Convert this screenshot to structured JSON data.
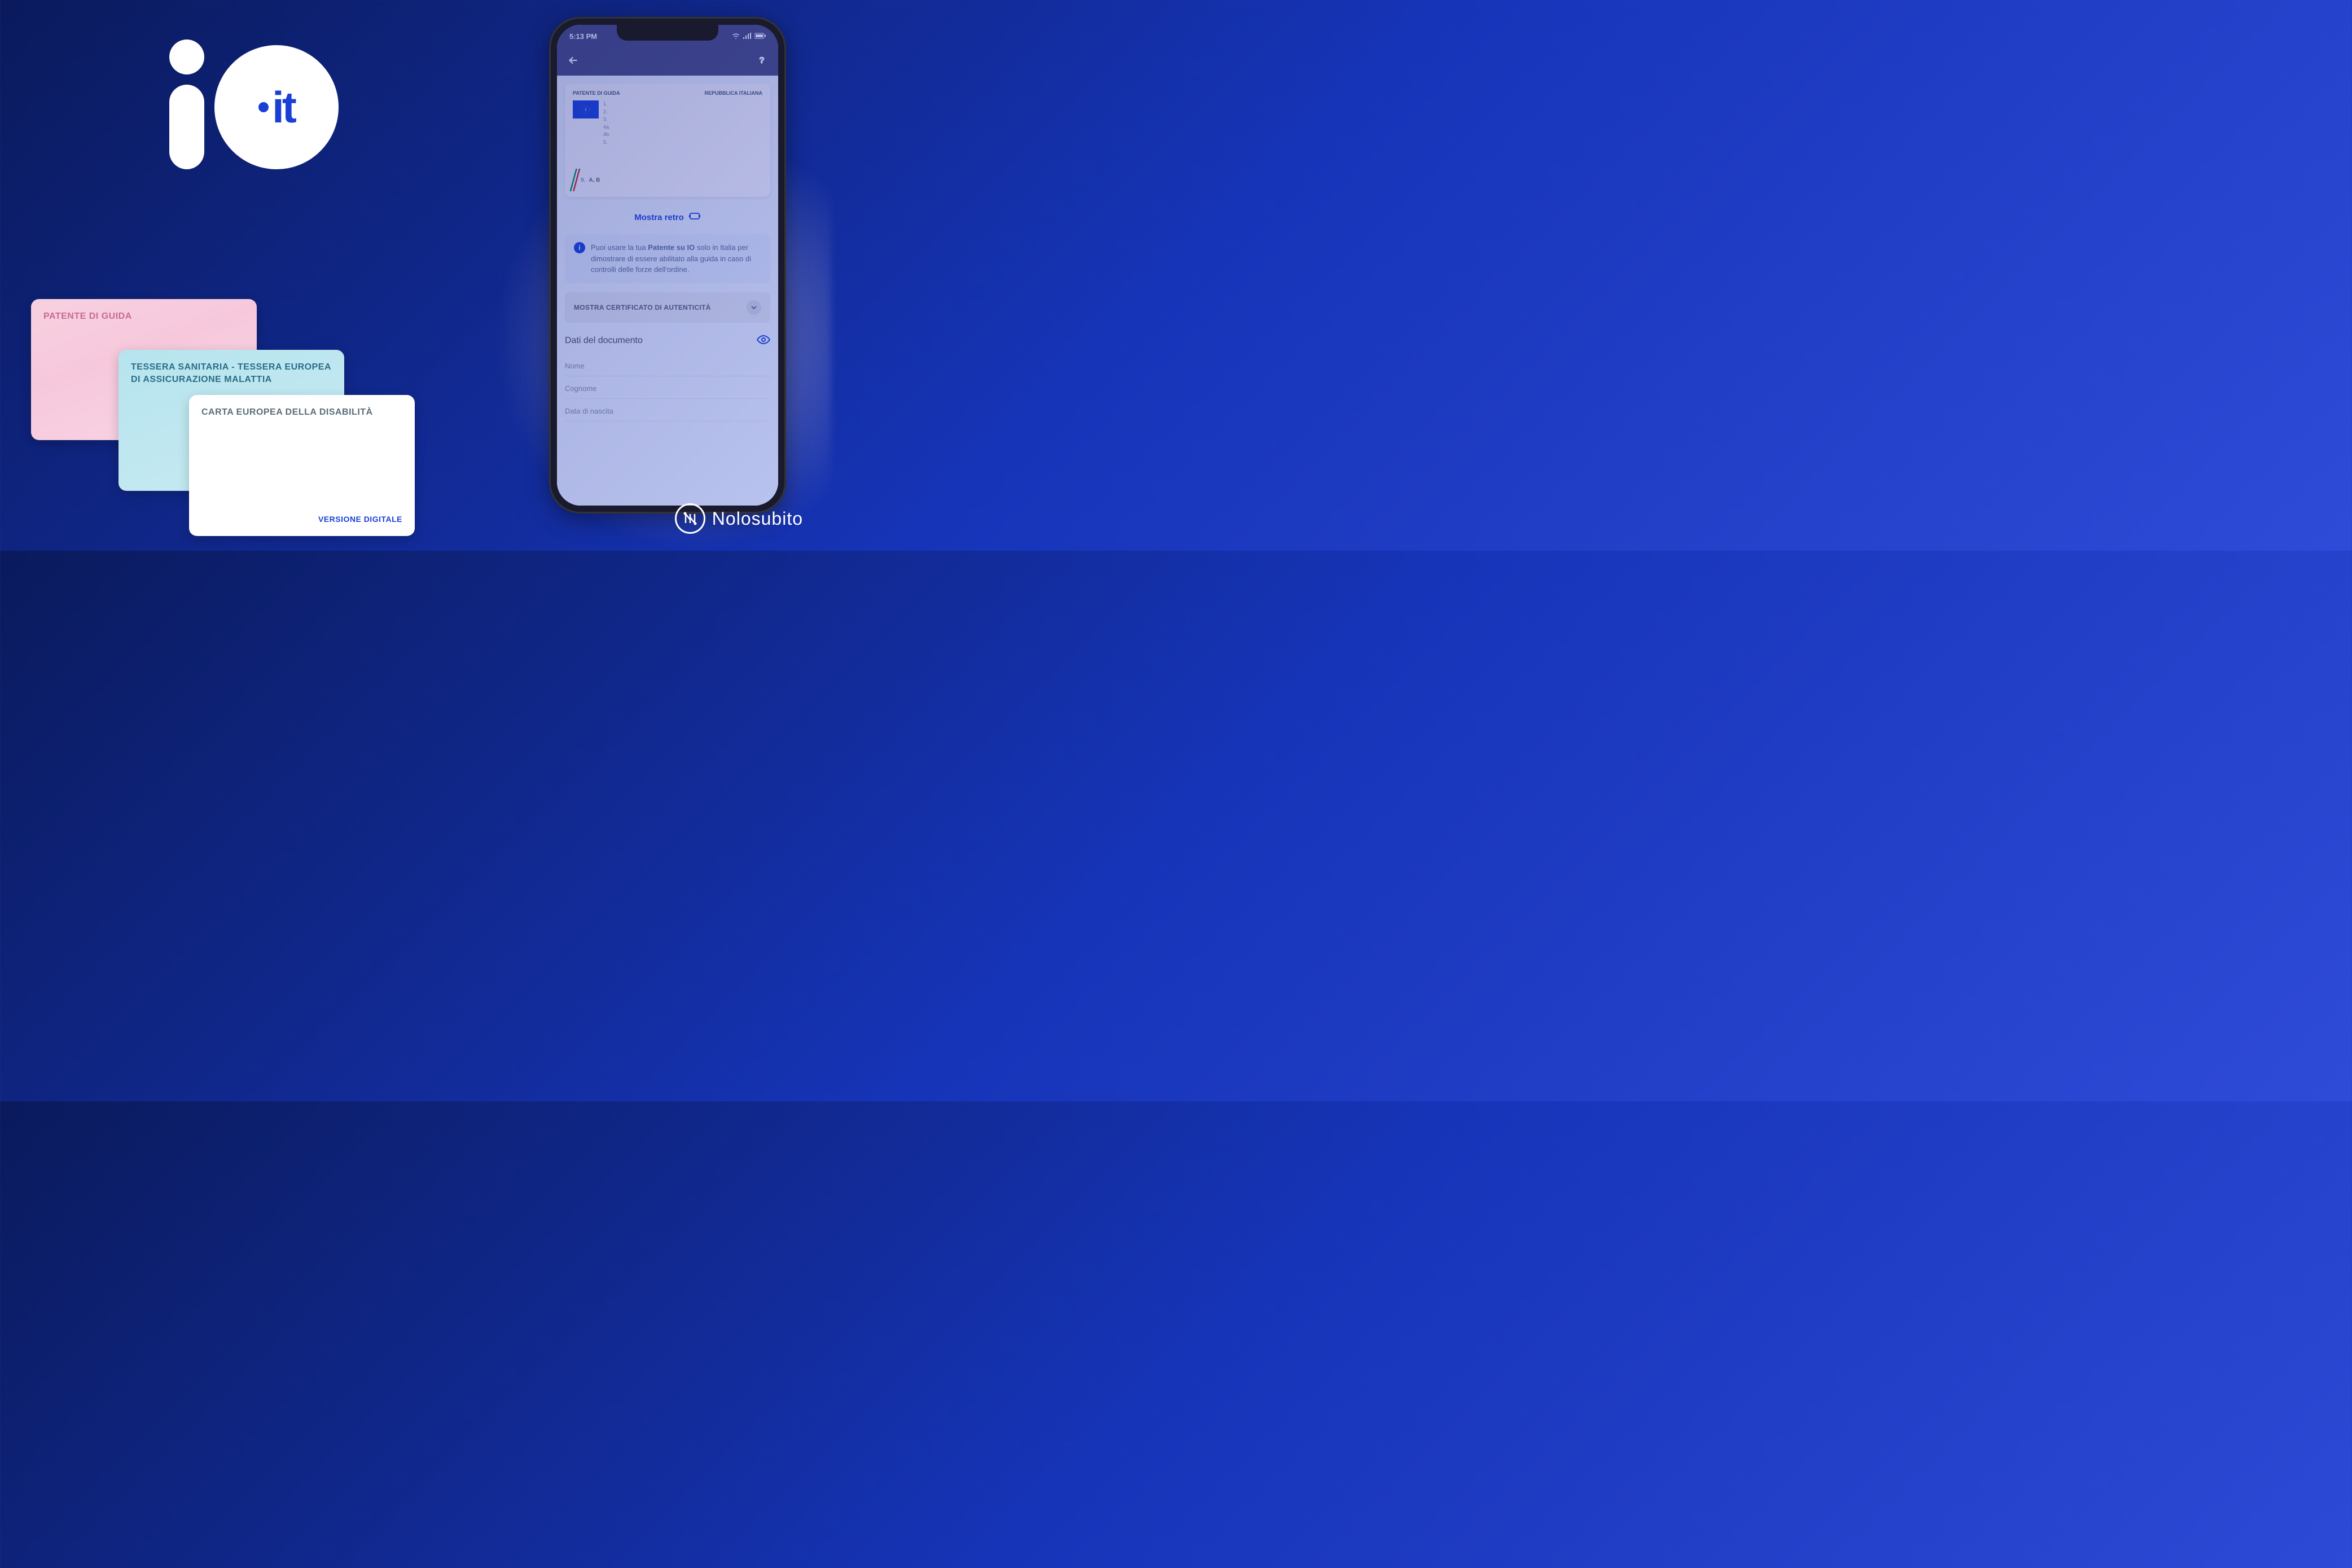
{
  "logo": {
    "it_text": "it"
  },
  "cards": {
    "pink": "PATENTE DI GUIDA",
    "cyan": "TESSERA SANITARIA - TESSERA EUROPEA DI ASSICURAZIONE MALATTIA",
    "white": "CARTA EUROPEA DELLA DISABILITÀ",
    "white_footer": "VERSIONE DIGITALE"
  },
  "phone": {
    "status": {
      "time": "5:13 PM"
    },
    "license": {
      "title_left": "PATENTE DI GUIDA",
      "title_right": "REPUBBLICA ITALIANA",
      "rows": [
        "1.",
        "2.",
        "3.",
        "4a.",
        "4b.",
        "5."
      ],
      "categories_label": "9.",
      "categories": "A, B"
    },
    "show_back": "Mostra retro",
    "info": "Puoi usare la tua Patente su IO solo in Italia per dimostrare di essere abilitato alla guida in caso di controlli delle forze dell'ordine.",
    "info_bold": "Patente su IO",
    "cert_button": "MOSTRA CERTIFICATO DI AUTENTICITÀ",
    "section": "Dati del documento",
    "fields": {
      "nome": "Nome",
      "cognome": "Cognome",
      "nascita": "Data di nascita"
    }
  },
  "watermark": "Nolosubito"
}
